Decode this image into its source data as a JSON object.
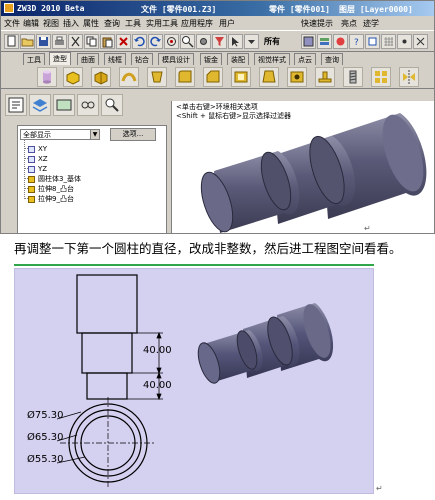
{
  "window": {
    "title": "ZW3D 2010 Beta",
    "file_label": "文件 [零件001.Z3]",
    "part_label": "零件 [零件001]",
    "layer_label": "图层 [Layer0000]"
  },
  "menu": [
    "文件",
    "编辑",
    "视图",
    "插入",
    "属性",
    "查询",
    "工具",
    "实用工具",
    "应用程序",
    "用户",
    "快速提示",
    "亮点",
    "迹学"
  ],
  "toolbar": {
    "filter_label": "所有"
  },
  "tabs": [
    "工具",
    "造型",
    "曲面",
    "线框",
    "钻合",
    "模具设计",
    "钣金",
    "装配",
    "视觉样式",
    "点云",
    "查询"
  ],
  "active_tab_index": 1,
  "panel": {
    "display_mode": "全部显示",
    "options_button": "选项...",
    "tree_items": [
      "XY",
      "XZ",
      "YZ",
      "圆柱体3_基体",
      "拉伸8_凸台",
      "拉伸9_凸台"
    ]
  },
  "viewport": {
    "hint_line1": "<单击右键>环境相关选项",
    "hint_line2": "<Shift + 鼠标右键>显示选择过滤器"
  },
  "caption": "再调整一下第一个圆柱的直径，改成非整数，然后进工程图空间看看。",
  "drawing": {
    "dim_height_1": "40.00",
    "dim_height_2": "40.00",
    "dia_1": "Ø75.30",
    "dia_2": "Ø65.30",
    "dia_3": "Ø55.30"
  },
  "return_mark": "↵",
  "colors": {
    "title_bar": "#0a246a",
    "app_bg": "#d4d0c8",
    "drawing_bg": "#d4d0f0",
    "model": "#5a5a78",
    "separator": "#2fa64a"
  }
}
